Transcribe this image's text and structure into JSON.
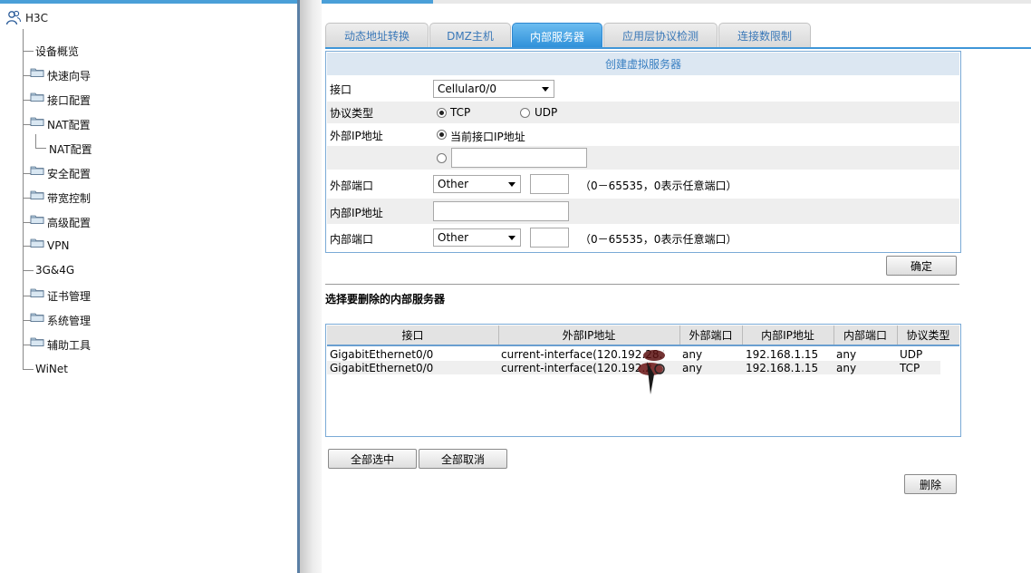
{
  "tree": {
    "root": "H3C",
    "items": [
      {
        "label": "设备概览",
        "folder": false
      },
      {
        "label": "快速向导",
        "folder": true
      },
      {
        "label": "接口配置",
        "folder": true
      },
      {
        "label": "NAT配置",
        "folder": true,
        "open": true
      },
      {
        "label": "安全配置",
        "folder": true
      },
      {
        "label": "带宽控制",
        "folder": true
      },
      {
        "label": "高级配置",
        "folder": true
      },
      {
        "label": "VPN",
        "folder": true
      },
      {
        "label": "3G&4G",
        "folder": false
      },
      {
        "label": "证书管理",
        "folder": true
      },
      {
        "label": "系统管理",
        "folder": true
      },
      {
        "label": "辅助工具",
        "folder": true
      },
      {
        "label": "WiNet",
        "folder": false
      }
    ],
    "sub_item": "NAT配置"
  },
  "tabs": [
    {
      "label": "动态地址转换",
      "active": false
    },
    {
      "label": "DMZ主机",
      "active": false
    },
    {
      "label": "内部服务器",
      "active": true
    },
    {
      "label": "应用层协议检测",
      "active": false
    },
    {
      "label": "连接数限制",
      "active": false
    }
  ],
  "form": {
    "header": "创建虚拟服务器",
    "interface_label": "接口",
    "interface_value": "Cellular0/0",
    "protocol_label": "协议类型",
    "protocol_tcp": "TCP",
    "protocol_udp": "UDP",
    "protocol_selected": "TCP",
    "ext_ip_label": "外部IP地址",
    "ext_ip_option_current": "当前接口IP地址",
    "ext_ip_custom_value": "",
    "ext_port_label": "外部端口",
    "ext_port_select": "Other",
    "ext_port_value": "",
    "port_hint": "（0－65535，0表示任意端口）",
    "int_ip_label": "内部IP地址",
    "int_ip_value": "",
    "int_port_label": "内部端口",
    "int_port_select": "Other",
    "int_port_value": "",
    "confirm_button": "确定"
  },
  "delete_section": {
    "title": "选择要删除的内部服务器",
    "columns": [
      "接口",
      "外部IP地址",
      "外部端口",
      "内部IP地址",
      "内部端口",
      "协议类型"
    ],
    "rows": [
      [
        "GigabitEthernet0/0",
        "current-interface(120.192.28.1",
        "any",
        "192.168.1.15",
        "any",
        "UDP"
      ],
      [
        "GigabitEthernet0/0",
        "current-interface(120.192.2",
        "any",
        "192.168.1.15",
        "any",
        "TCP"
      ]
    ],
    "select_all_button": "全部选中",
    "deselect_all_button": "全部取消",
    "delete_button": "删除"
  }
}
